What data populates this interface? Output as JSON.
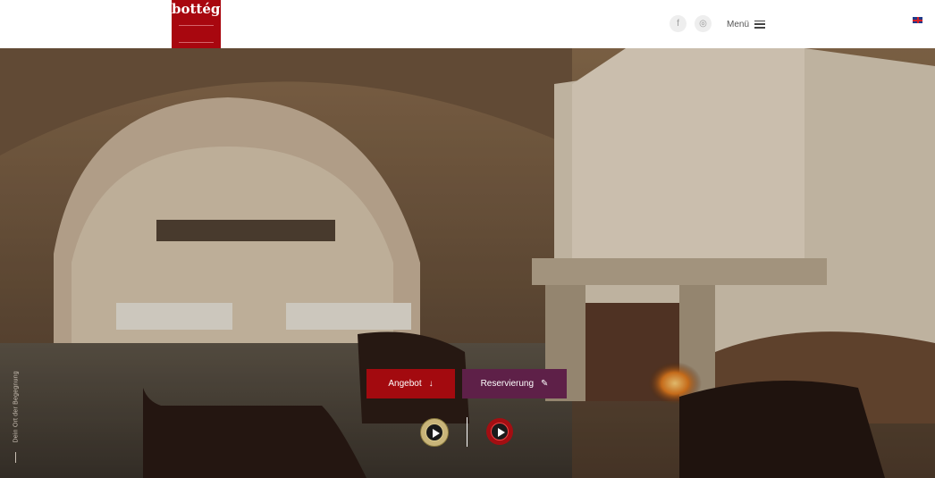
{
  "header": {
    "logo_text": "bottéga",
    "menu_label": "Menü",
    "social": [
      "facebook-icon",
      "tripadvisor-icon"
    ],
    "language_flag": "uk-flag-icon"
  },
  "hero": {
    "side_tagline": "Dein Ort der Begegnung",
    "offer_button": "Angebot",
    "offer_icon": "↓",
    "reserve_button": "Reservierung",
    "reserve_icon": "✎"
  },
  "colors": {
    "brand_red": "#a8070f",
    "reserve_purple": "#5e2048"
  }
}
